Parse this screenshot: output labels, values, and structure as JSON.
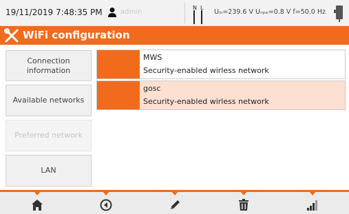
{
  "status": {
    "datetime": "19/11/2019 7:48:35 PM",
    "user": "admin",
    "probe_n": "N",
    "probe_l": "L",
    "readings": "Uₗₙ=239.6 V Uₙₚₑ=0.8 V f=50.0 Hz"
  },
  "title": "WiFi configuration",
  "nav": {
    "connection": "Connection information",
    "available": "Available networks",
    "preferred": "Preferred network",
    "lan": "LAN"
  },
  "networks": [
    {
      "name": "MWS",
      "security": "Security-enabled wirless network"
    },
    {
      "name": "gosc",
      "security": "Security-enabled wirless network"
    }
  ],
  "toolbar": [
    "home-icon",
    "back-icon",
    "edit-icon",
    "delete-icon",
    "signal-icon"
  ],
  "colors": {
    "accent": "#f26a1b",
    "selected_row": "#fde0d2"
  }
}
